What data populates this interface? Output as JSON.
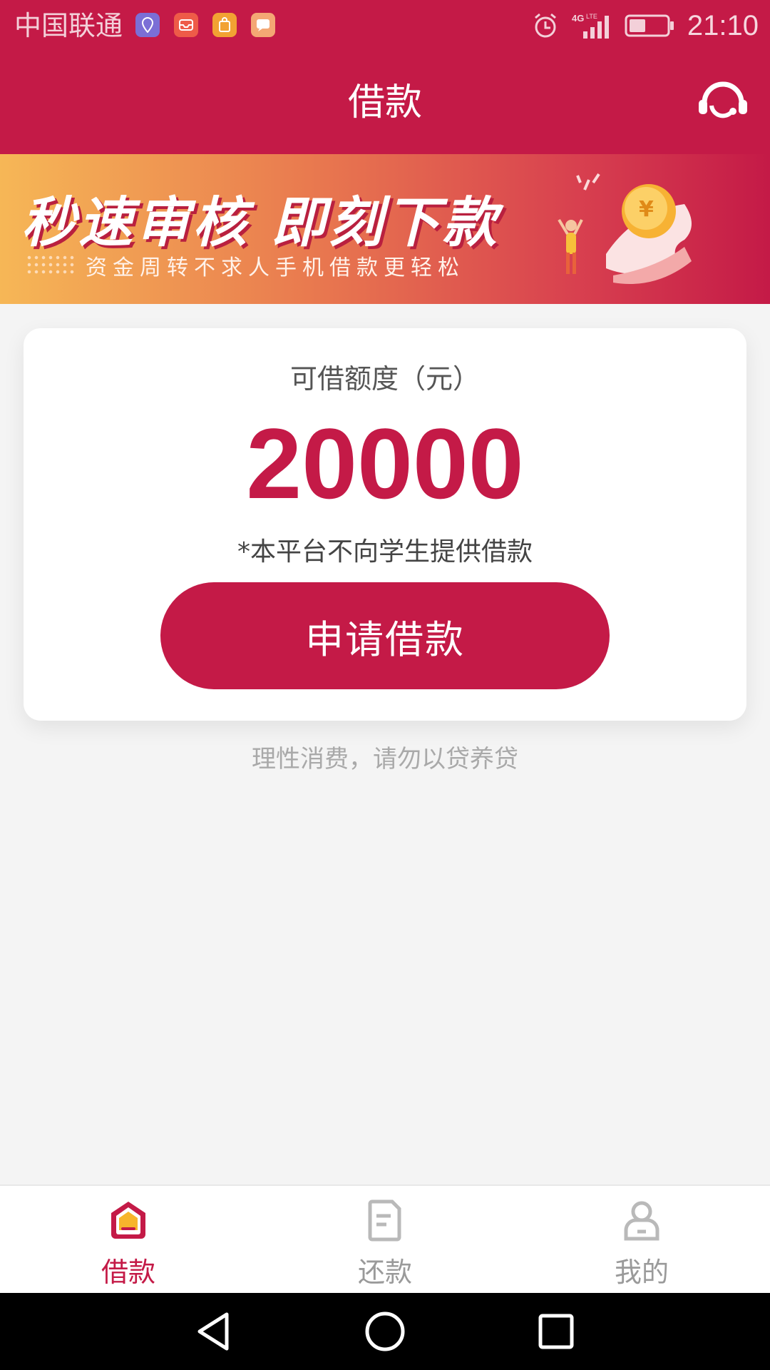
{
  "status_bar": {
    "carrier": "中国联通",
    "time": "21:10",
    "network": "4G LTE",
    "app_icons": [
      "location-app-icon",
      "mail-app-icon",
      "bag-app-icon",
      "chat-app-icon"
    ]
  },
  "header": {
    "title": "借款",
    "service_icon": "headset-icon"
  },
  "banner": {
    "headline": "秒速审核  即刻下款",
    "subline": "资金周转不求人手机借款更轻松"
  },
  "card": {
    "limit_label": "可借额度（元）",
    "limit_amount": "20000",
    "notice": "*本平台不向学生提供借款",
    "apply_button": "申请借款"
  },
  "footnote": "理性消费，请勿以贷养贷",
  "tabs": [
    {
      "label": "借款",
      "icon": "home-icon",
      "active": true
    },
    {
      "label": "还款",
      "icon": "document-icon",
      "active": false
    },
    {
      "label": "我的",
      "icon": "user-icon",
      "active": false
    }
  ],
  "colors": {
    "brand": "#c41a47",
    "inactive": "#9a9a9a",
    "background": "#f4f4f4"
  }
}
